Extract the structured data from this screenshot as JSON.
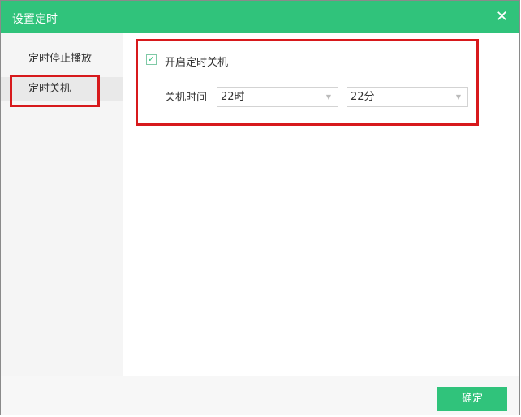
{
  "title": "设置定时",
  "close_icon": "close-icon",
  "sidebar": {
    "items": [
      {
        "label": "定时停止播放"
      },
      {
        "label": "定时关机"
      }
    ]
  },
  "main": {
    "enable_label": "开启定时关机",
    "enabled": true,
    "time_label": "关机时间",
    "hour": "22时",
    "minute": "22分"
  },
  "footer": {
    "ok_label": "确定"
  },
  "colors": {
    "accent": "#30c37b",
    "highlight": "#d7191c"
  }
}
